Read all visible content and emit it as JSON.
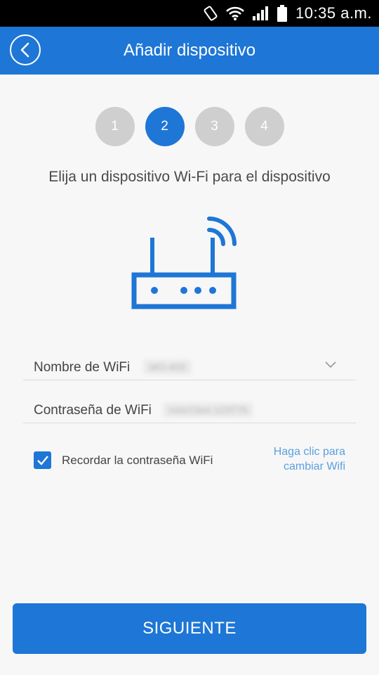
{
  "status_bar": {
    "time": "10:35 a.m.",
    "icons": [
      "rotation-lock-icon",
      "wifi-icon",
      "cellular-signal-icon",
      "battery-icon"
    ]
  },
  "app_bar": {
    "title": "Añadir dispositivo",
    "back_icon": "chevron-left-icon",
    "background": "#1e76d6"
  },
  "steps": {
    "items": [
      "1",
      "2",
      "3",
      "4"
    ],
    "active": "2",
    "active_color": "#1e76d6",
    "inactive_color": "#cfcfcf"
  },
  "instruction": "Elija un dispositivo Wi-Fi para el dispositivo",
  "illustration": {
    "icon": "wifi-router-icon",
    "color": "#1e76d6"
  },
  "form": {
    "wifi_name": {
      "label": "Nombre de WiFi",
      "value": "MO-403"
    },
    "wifi_password": {
      "label": "Contraseña de WiFi",
      "value": "roisr13ws 123T75"
    },
    "remember": {
      "label": "Recordar la contraseña WiFi",
      "checked": true
    },
    "change_wifi_line1": "Haga clic para",
    "change_wifi_line2": "cambiar Wifi"
  },
  "next_button": "SIGUIENTE"
}
